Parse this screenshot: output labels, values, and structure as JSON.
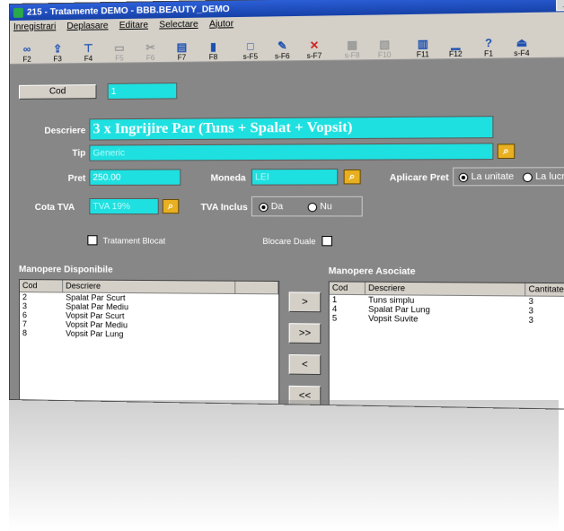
{
  "window": {
    "title": "215 - Tratamente    DEMO - BBB.BEAUTY_DEMO",
    "minimize_label": "_ |"
  },
  "menu": [
    "Inregistrari",
    "Deplasare",
    "Editare",
    "Selectare",
    "Ajutor"
  ],
  "toolbar": [
    {
      "icon": "binoculars-icon",
      "label": "F2",
      "disabled": false
    },
    {
      "icon": "export-icon",
      "label": "F3",
      "disabled": false
    },
    {
      "icon": "filter-icon",
      "label": "F4",
      "disabled": false
    },
    {
      "icon": "copy-icon",
      "label": "F5",
      "disabled": true
    },
    {
      "icon": "cut-icon",
      "label": "F6",
      "disabled": true
    },
    {
      "icon": "paste-icon",
      "label": "F7",
      "disabled": false
    },
    {
      "icon": "save-icon",
      "label": "F8",
      "disabled": false
    },
    {
      "icon": "new-icon",
      "label": "s-F5",
      "disabled": false
    },
    {
      "icon": "edit-icon",
      "label": "s-F6",
      "disabled": false
    },
    {
      "icon": "delete-icon",
      "label": "s-F7",
      "disabled": false
    },
    {
      "icon": "print-icon",
      "label": "s-F8",
      "disabled": true
    },
    {
      "icon": "preview-icon",
      "label": "F10",
      "disabled": true
    },
    {
      "icon": "grid-icon",
      "label": "F11",
      "disabled": false
    },
    {
      "icon": "chart-icon",
      "label": "F12",
      "disabled": false
    },
    {
      "icon": "help-icon",
      "label": "F1",
      "disabled": false
    },
    {
      "icon": "exit-icon",
      "label": "s-F4",
      "disabled": false
    }
  ],
  "form": {
    "cod_button": "Cod",
    "cod_value": "1",
    "descriere_label": "Descriere",
    "descriere_value": "3 x Ingrijire Par (Tuns + Spalat + Vopsit)",
    "tip_label": "Tip",
    "tip_value": "Generic",
    "pret_label": "Pret",
    "pret_value": "250.00",
    "moneda_label": "Moneda",
    "moneda_value": "LEI",
    "aplicare_label": "Aplicare Pret",
    "aplicare_options": [
      "La unitate",
      "La lucrare"
    ],
    "aplicare_selected": 0,
    "cota_label": "Cota TVA",
    "cota_value": "TVA 19%",
    "tva_label": "TVA Inclus",
    "tva_options": [
      "Da",
      "Nu"
    ],
    "tva_selected": 0,
    "tratament_label": "Tratament Blocat",
    "blocare_label": "Blocare Duale"
  },
  "disponibile": {
    "title": "Manopere Disponibile",
    "headers": [
      "Cod",
      "Descriere"
    ],
    "rows": [
      [
        "2",
        "Spalat Par Scurt"
      ],
      [
        "3",
        "Spalat Par Mediu"
      ],
      [
        "6",
        "Vopsit Par Scurt"
      ],
      [
        "7",
        "Vopsit Par Mediu"
      ],
      [
        "8",
        "Vopsit Par Lung"
      ]
    ]
  },
  "asociate": {
    "title": "Manopere Asociate",
    "headers": [
      "Cod",
      "Descriere",
      "Cantitate"
    ],
    "rows": [
      [
        "1",
        "Tuns simplu",
        "3"
      ],
      [
        "4",
        "Spalat Par Lung",
        "3"
      ],
      [
        "5",
        "Vopsit Suvite",
        "3"
      ]
    ]
  },
  "transfer": {
    "add": ">",
    "add_all": ">>",
    "remove": "<",
    "remove_all": "<<"
  }
}
